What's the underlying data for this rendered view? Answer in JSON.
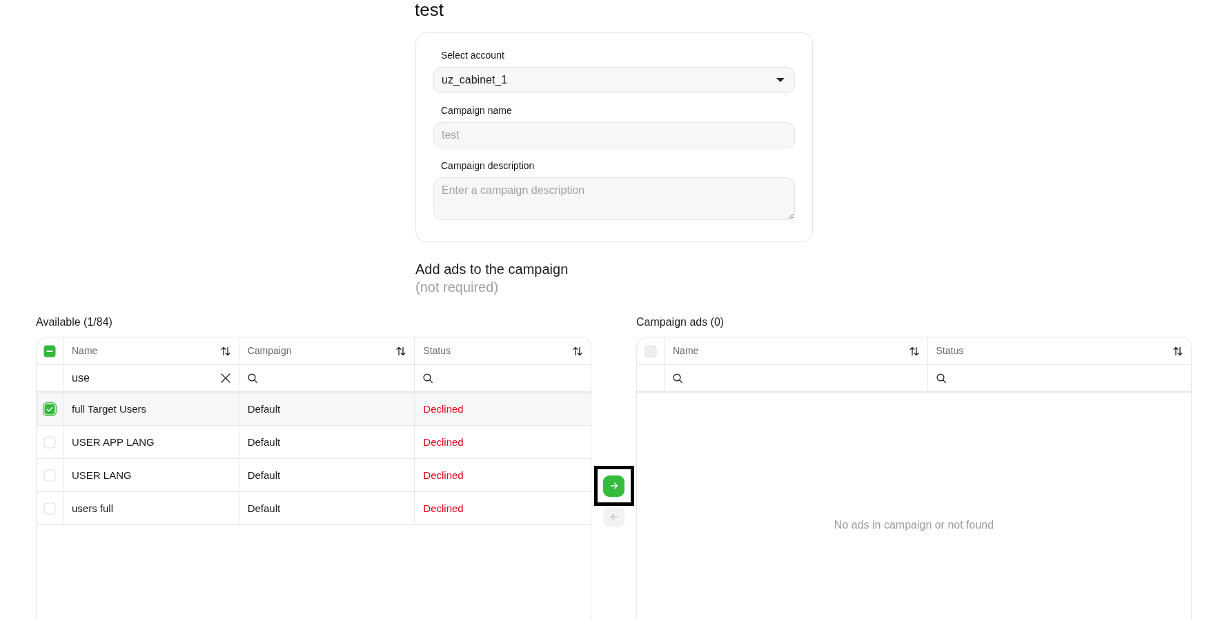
{
  "page": {
    "title": "test"
  },
  "form": {
    "fields": [
      {
        "kind": "select",
        "label": "Select account",
        "value": "uz_cabinet_1"
      },
      {
        "kind": "input",
        "label": "Campaign name",
        "placeholder": "test"
      },
      {
        "kind": "textarea",
        "label": "Campaign description",
        "placeholder": "Enter a campaign description"
      }
    ]
  },
  "ads_section": {
    "title": "Add ads to the campaign",
    "note": "(not required)"
  },
  "available": {
    "title": "Available (1/84)",
    "select_all": {
      "checked": false,
      "mixed": true,
      "disabled": false
    },
    "columns": [
      {
        "label": "Name"
      },
      {
        "label": "Campaign"
      },
      {
        "label": "Status"
      }
    ],
    "filters": [
      {
        "kind": "filled",
        "value": "use"
      },
      {
        "kind": "empty"
      },
      {
        "kind": "empty"
      }
    ],
    "rows": [
      {
        "selected": true,
        "name": "full Target Users",
        "campaign": "Default",
        "status": "Declined"
      },
      {
        "selected": false,
        "name": "USER APP LANG",
        "campaign": "Default",
        "status": "Declined"
      },
      {
        "selected": false,
        "name": "USER LANG",
        "campaign": "Default",
        "status": "Declined"
      },
      {
        "selected": false,
        "name": "users full",
        "campaign": "Default",
        "status": "Declined"
      }
    ]
  },
  "transfer_buttons": [
    {
      "kind": "add",
      "disabled": false,
      "highlighted": true
    },
    {
      "kind": "remove",
      "disabled": true,
      "highlighted": false
    }
  ],
  "campaign_ads": {
    "title": "Campaign ads (0)",
    "select_all": {
      "checked": false,
      "mixed": false,
      "disabled": true
    },
    "columns": [
      {
        "label": "Name"
      },
      {
        "label": "Status"
      }
    ],
    "filters": [
      {
        "kind": "empty"
      },
      {
        "kind": "empty"
      }
    ],
    "empty_message": "No ads in campaign or not found"
  }
}
